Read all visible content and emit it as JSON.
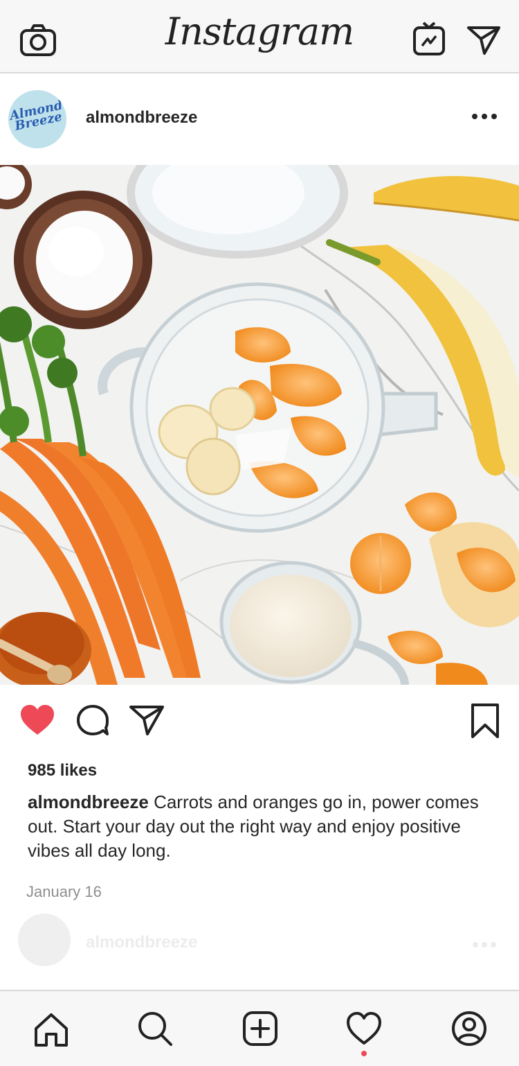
{
  "app": {
    "title": "Instagram"
  },
  "post": {
    "username": "almondbreeze",
    "avatar_brand": "Almond Breeze",
    "likes": "985 likes",
    "caption_user": "almondbreeze",
    "caption_text": "Carrots and oranges go in, power comes out. Start your day out the right way and enjoy positive vibes all day long.",
    "date": "January 16",
    "liked": true
  },
  "next_post": {
    "username": "almondbreeze"
  },
  "icons": {
    "top_left": "camera-icon",
    "top_right_1": "igtv-icon",
    "top_right_2": "direct-message-icon",
    "actions": [
      "heart-icon",
      "comment-icon",
      "share-icon",
      "bookmark-icon"
    ],
    "nav": [
      "home-icon",
      "search-icon",
      "add-post-icon",
      "activity-heart-icon",
      "profile-icon"
    ]
  },
  "colors": {
    "like_red": "#ed4956",
    "text": "#262626",
    "muted": "#8e8e8e",
    "bar_bg": "#f7f7f8",
    "avatar_bg": "#bfe1ec",
    "brand_blue": "#2a5db0"
  }
}
